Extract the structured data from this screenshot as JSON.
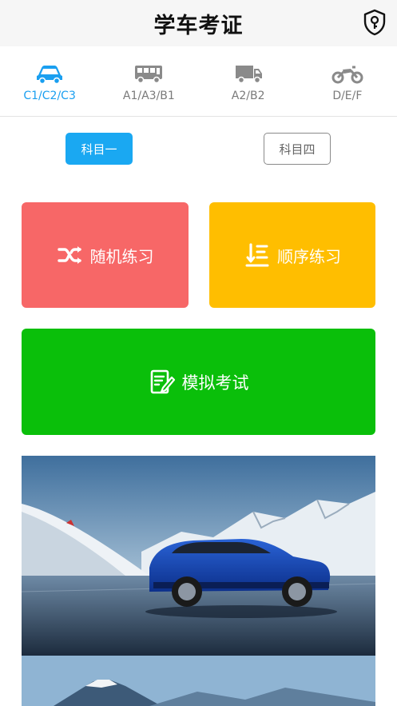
{
  "header": {
    "title": "学车考证",
    "icon": "shield-key-icon"
  },
  "license_types": [
    {
      "label": "C1/C2/C3",
      "icon": "car-icon",
      "active": true
    },
    {
      "label": "A1/A3/B1",
      "icon": "bus-icon",
      "active": false
    },
    {
      "label": "A2/B2",
      "icon": "truck-icon",
      "active": false
    },
    {
      "label": "D/E/F",
      "icon": "motorcycle-icon",
      "active": false
    }
  ],
  "subjects": {
    "subject1": "科目一",
    "subject4": "科目四"
  },
  "actions": {
    "random": "随机练习",
    "order": "顺序练习",
    "exam": "模拟考试"
  },
  "colors": {
    "accent": "#1aa8f2",
    "random_tile": "#f76767",
    "order_tile": "#ffbe00",
    "exam_tile": "#0abf0a"
  }
}
